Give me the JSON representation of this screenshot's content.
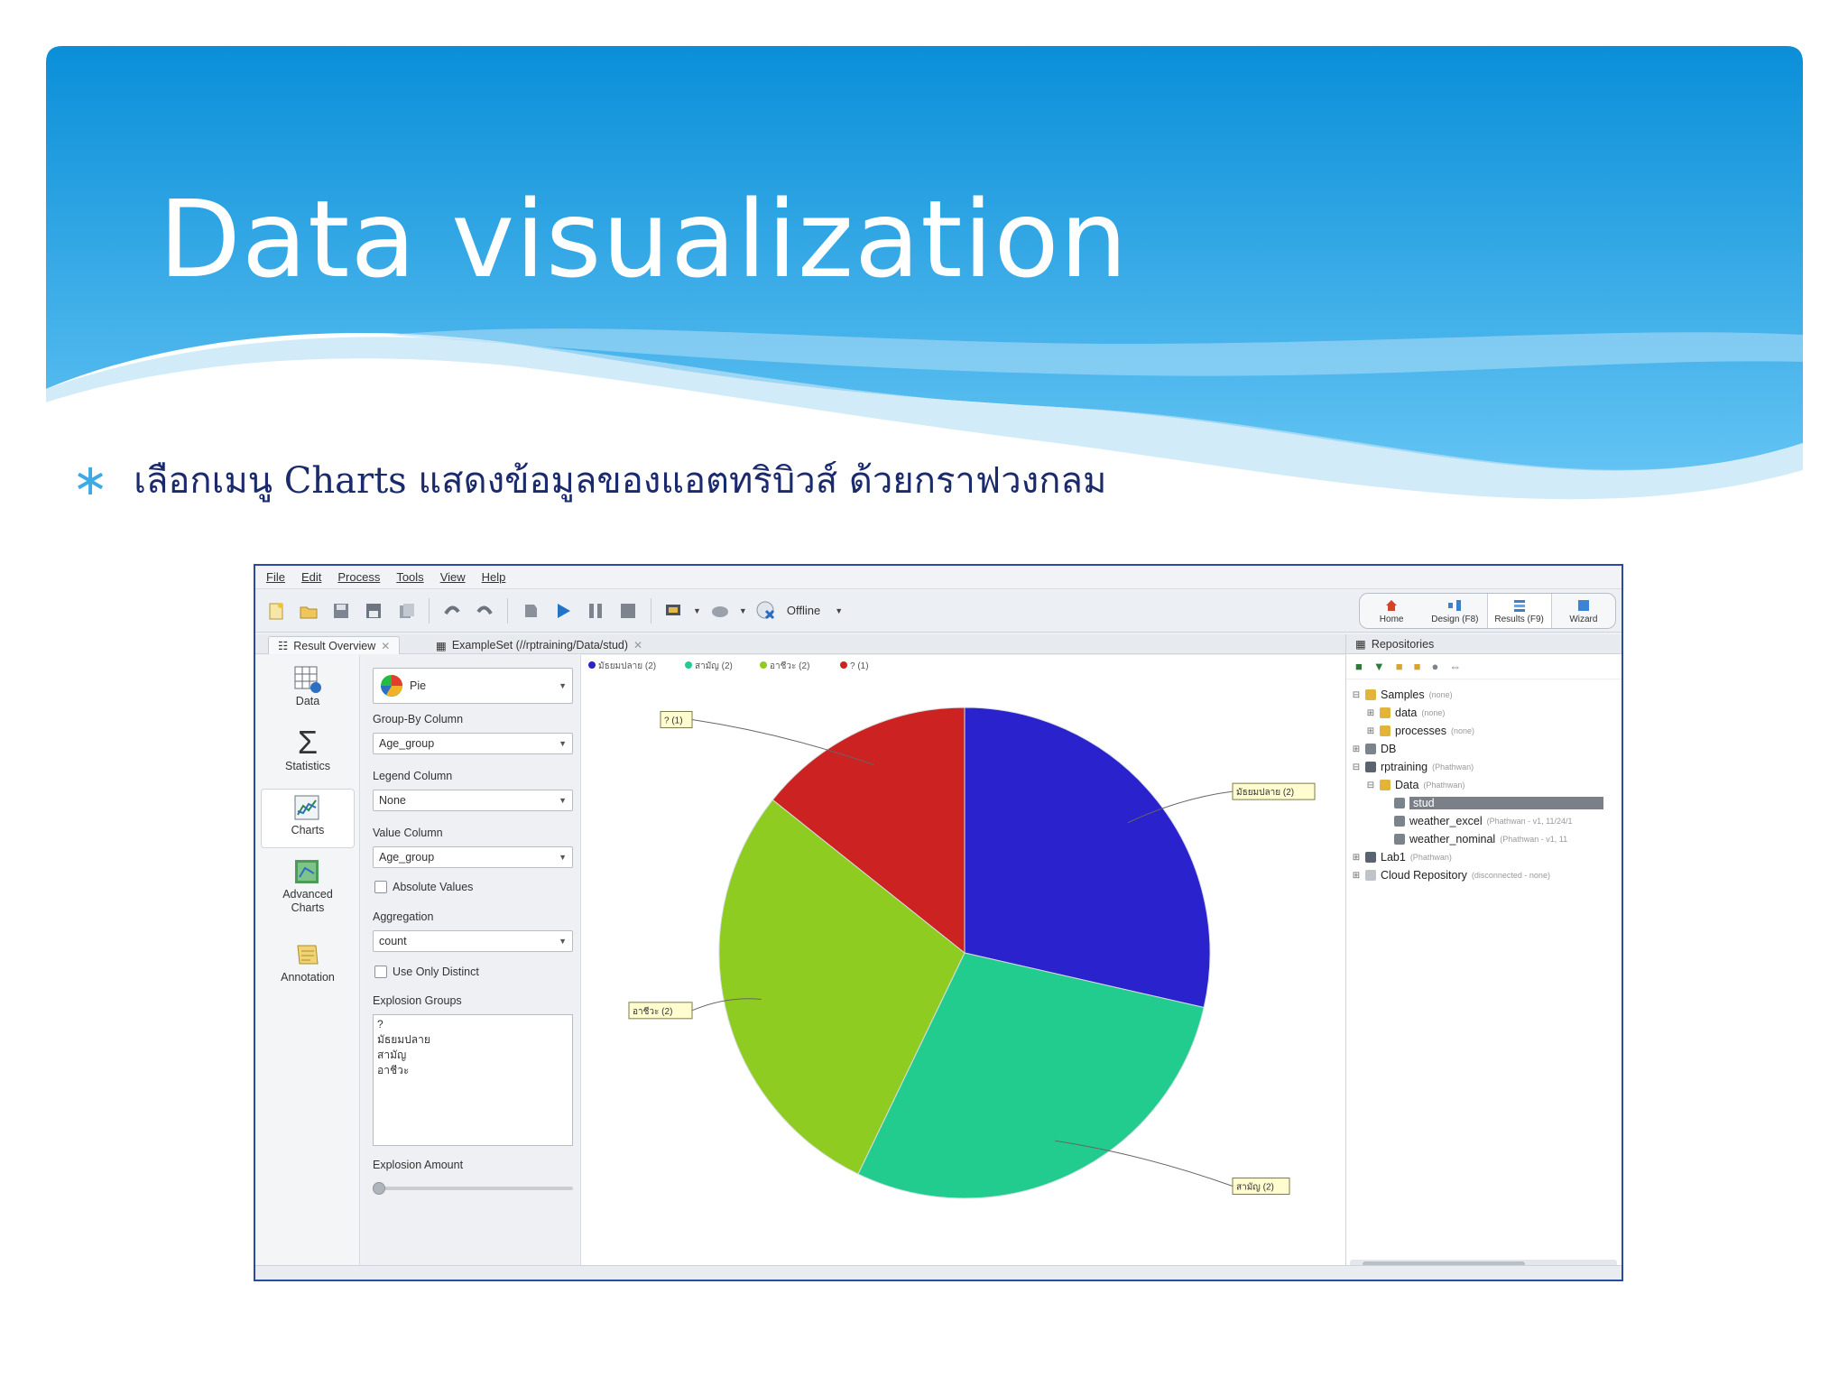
{
  "slide": {
    "title": "Data visualization",
    "bullet": "เลือกเมนู Charts แสดงข้อมูลของแอตทริบิวส์ ด้วยกราฟวงกลม",
    "colors": {
      "header_top": "#0a8fd8",
      "header_bottom": "#5fc0f2",
      "bullet": "#3fa9e6",
      "text": "#1a2a6c"
    }
  },
  "app": {
    "menu": [
      "File",
      "Edit",
      "Process",
      "Tools",
      "View",
      "Help"
    ],
    "toolbar": {
      "icons": [
        "new-process-icon",
        "open-icon",
        "save-icon",
        "save-as-icon",
        "export-icon",
        "undo-icon",
        "redo-icon",
        "stop-all-icon",
        "run-icon",
        "pause-icon",
        "stop-icon",
        "resource-icon",
        "cloud-icon",
        "offline-icon"
      ],
      "offline_label": "Offline"
    },
    "perspectives": [
      {
        "label": "Home",
        "icon": "home-icon"
      },
      {
        "label": "Design (F8)",
        "icon": "design-icon"
      },
      {
        "label": "Results (F9)",
        "icon": "results-icon"
      },
      {
        "label": "Wizard",
        "icon": "wizard-icon"
      }
    ],
    "tabs": [
      {
        "label": "Result Overview"
      },
      {
        "label": "ExampleSet (//rptraining/Data/stud)"
      }
    ],
    "leftnav": [
      "Data",
      "Statistics",
      "Charts",
      "Advanced Charts",
      "Annotation"
    ],
    "settings": {
      "chart_type": "Pie",
      "group_by_label": "Group-By Column",
      "group_by_value": "Age_group",
      "legend_label": "Legend Column",
      "legend_value": "None",
      "value_label": "Value Column",
      "value_value": "Age_group",
      "absolute_values": "Absolute Values",
      "aggregation_label": "Aggregation",
      "aggregation_value": "count",
      "use_only_distinct": "Use Only Distinct",
      "explosion_groups_label": "Explosion Groups",
      "explosion_groups": [
        "?",
        "มัธยมปลาย",
        "สามัญ",
        "อาชีวะ"
      ],
      "explosion_amount_label": "Explosion Amount"
    },
    "repository": {
      "title": "Repositories",
      "items": [
        {
          "label": "Samples",
          "meta": "(none)"
        },
        {
          "label": "data",
          "meta": "(none)"
        },
        {
          "label": "processes",
          "meta": "(none)"
        },
        {
          "label": "DB",
          "meta": ""
        },
        {
          "label": "rptraining",
          "meta": "(Phathwan)"
        },
        {
          "label": "Data",
          "meta": "(Phathwan)"
        },
        {
          "label": "stud",
          "meta": ""
        },
        {
          "label": "weather_excel",
          "meta": "(Phathwan - v1, 11/24/1"
        },
        {
          "label": "weather_nominal",
          "meta": "(Phathwan - v1, 11"
        },
        {
          "label": "Lab1",
          "meta": "(Phathwan)"
        },
        {
          "label": "Cloud Repository",
          "meta": "(disconnected - none)"
        }
      ]
    }
  },
  "chart_data": {
    "type": "pie",
    "categories": [
      "มัธยมปลาย",
      "สามัญ",
      "อาชีวะ",
      "?"
    ],
    "values": [
      2,
      2,
      2,
      1
    ],
    "labels": [
      "มัธยมปลาย (2)",
      "สามัญ (2)",
      "อาชีวะ (2)",
      "? (1)"
    ],
    "legend": [
      "มัธยมปลาย (2)",
      "สามัญ (2)",
      "อาชีวะ (2)",
      "? (1)"
    ],
    "colors": [
      "#2a22cc",
      "#22cc8f",
      "#8fcc22",
      "#cc2222"
    ],
    "legend_position": "top-left"
  }
}
